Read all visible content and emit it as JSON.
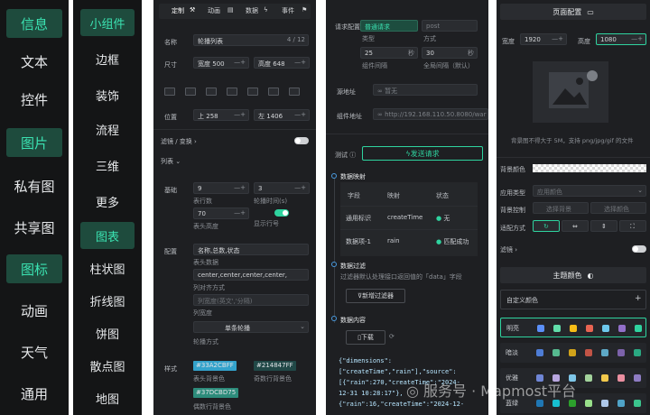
{
  "categories": {
    "items": [
      "信息",
      "文本",
      "控件",
      "图片",
      "私有图",
      "共享图",
      "图标",
      "动画",
      "天气",
      "通用"
    ],
    "active": [
      "信息",
      "图片",
      "图标"
    ]
  },
  "subcategories": {
    "items": [
      "小组件",
      "边框",
      "装饰",
      "流程",
      "三维",
      "更多",
      "图表",
      "柱状图",
      "折线图",
      "饼图",
      "散点图",
      "地图"
    ],
    "active": [
      "小组件",
      "图表"
    ]
  },
  "props": {
    "tabs": [
      "定制",
      "动画",
      "数据",
      "事件"
    ],
    "name_label": "名称",
    "name_value": "轮播列表",
    "name_count": "4 / 12",
    "size_label": "尺寸",
    "width_label": "宽度",
    "width_value": "500",
    "height_label": "高度",
    "height_value": "648",
    "pos_label": "位置",
    "top_label": "上",
    "top_value": "258",
    "left_label": "左",
    "left_value": "1406",
    "filter_label": "滤镜 / 变换",
    "list_label": "列表",
    "base_label": "基础",
    "rows_value": "9",
    "rows_label": "表行数",
    "interval_value": "3",
    "interval_label": "轮播时间(s)",
    "header_height_value": "70",
    "header_height_label": "表头高度",
    "show_rownum_label": "显示行号",
    "config_label": "配置",
    "header_data_value": "名称,总数,状态",
    "header_data_label": "表头数据",
    "align_value": "center,center,center,center,",
    "align_label": "列对齐方式",
    "colwidth_placeholder": "列宽度(英文','分隔)",
    "colwidth_label": "列宽度",
    "carousel_value": "单条轮播",
    "carousel_label": "轮播方式",
    "style_label": "样式",
    "header_bg_value": "#33A2CBFF",
    "header_bg_label": "表头背景色",
    "odd_bg_value": "#214847FF",
    "odd_bg_label": "奇数行背景色",
    "even_bg_value": "#37DCBD75",
    "even_bg_label": "偶数行背景色"
  },
  "data_panel": {
    "req_config_label": "请求配置",
    "normal_req": "普通请求",
    "post": "post",
    "type_label": "类型",
    "method_label": "方式",
    "group_interval_value": "25",
    "group_interval_unit": "秒",
    "group_interval_label": "组件间隔",
    "global_interval_value": "30",
    "global_interval_unit": "秒",
    "global_interval_label": "全局间隔（默认）",
    "source_label": "源地址",
    "source_value": "暂无",
    "comp_addr_label": "组件地址",
    "comp_addr_value": "http://192.168.110.50.8080/war",
    "test_label": "测试",
    "send_request": "发送请求",
    "mapping_title": "数据映射",
    "table_headers": [
      "字段",
      "映射",
      "状态"
    ],
    "table_rows": [
      {
        "field": "通用标识",
        "map": "createTime",
        "status": "无"
      },
      {
        "field": "数据项-1",
        "map": "rain",
        "status": "匹配成功"
      }
    ],
    "filter_title": "数据过滤",
    "filter_desc": "过滤器默认处理接口返回值的「data」字段",
    "new_filter": "新增过滤器",
    "content_title": "数据内容",
    "download": "下载",
    "json_lines": [
      "{\"dimensions\":",
      "[\"createTime\",\"rain\"],\"source\":",
      "[{\"rain\":270,\"createTime\":\"2024-",
      "12-31 10:28:17\"},",
      "{\"rain\":16,\"createTime\":\"2024-12-"
    ]
  },
  "page_panel": {
    "title": "页面配置",
    "width_label": "宽度",
    "width_value": "1920",
    "height_label": "高度",
    "height_value": "1080",
    "upload_hint": "背景图不得大于 5M，支持 png/jpg/gif 的文件",
    "bg_color_label": "背景颜色",
    "app_type_label": "应用类型",
    "app_type_value": "应用颜色",
    "bg_control_label": "背景控制",
    "select_bg": "选择背景",
    "select_color": "选择颜色",
    "fit_label": "适配方式",
    "filter_label": "滤镜",
    "theme_title": "主题颜色",
    "custom_color": "自定义颜色",
    "themes": [
      {
        "name": "明亮",
        "colors": [
          "#5b8ff9",
          "#61ddaa",
          "#f6bd16",
          "#e86452",
          "#6dc8ec",
          "#9270ca",
          "#2fd39f"
        ]
      },
      {
        "name": "暗淡",
        "colors": [
          "#4e7dd6",
          "#56b98f",
          "#d1a31a",
          "#c25446",
          "#5ea9c7",
          "#7c62aa",
          "#2aa882"
        ]
      },
      {
        "name": "优雅",
        "colors": [
          "#6f86d6",
          "#b9a7e0",
          "#7ec6e8",
          "#a3d39c",
          "#f2c94c",
          "#eb8fa0",
          "#8e7cc3"
        ]
      },
      {
        "name": "蓝绿",
        "colors": [
          "#1f77b4",
          "#17becf",
          "#2ca02c",
          "#98df8a",
          "#aec7e8",
          "#4fa3c7",
          "#3bc48d"
        ]
      }
    ]
  },
  "watermark": "服务号 · Mapmost平台"
}
